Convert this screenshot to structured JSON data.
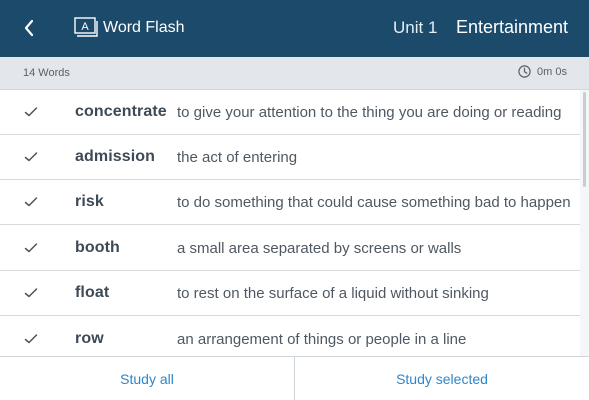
{
  "header": {
    "back_icon": "chevron-left-icon",
    "brand_icon": "word-flash-logo-icon",
    "brand_name": "Word Flash",
    "unit": "Unit 1",
    "topic": "Entertainment",
    "background_color": "#1c4a6b"
  },
  "subheader": {
    "word_count": "14 Words",
    "timer_icon": "clock-icon",
    "timer": "0m 0s"
  },
  "words": [
    {
      "word": "concentrate",
      "definition": "to give your attention to the thing you are doing or reading",
      "checked": true
    },
    {
      "word": "admission",
      "definition": "the act of entering",
      "checked": true
    },
    {
      "word": "risk",
      "definition": "to do something that could cause something bad to happen",
      "checked": true
    },
    {
      "word": "booth",
      "definition": "a small area separated by screens or walls",
      "checked": true
    },
    {
      "word": "float",
      "definition": "to rest on the surface of a liquid without sinking",
      "checked": true
    },
    {
      "word": "row",
      "definition": "an arrangement of things or people in a line",
      "checked": true
    }
  ],
  "footer": {
    "study_all": "Study all",
    "study_selected": "Study selected",
    "accent_color": "#2f86c6"
  }
}
